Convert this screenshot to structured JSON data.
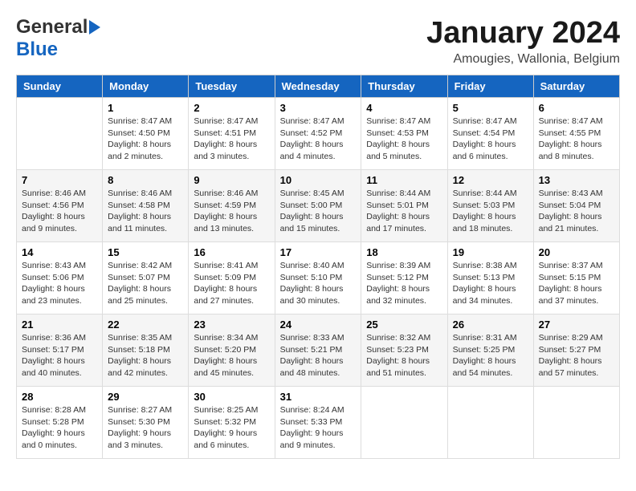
{
  "header": {
    "logo_general": "General",
    "logo_blue": "Blue",
    "month_title": "January 2024",
    "location": "Amougies, Wallonia, Belgium"
  },
  "weekdays": [
    "Sunday",
    "Monday",
    "Tuesday",
    "Wednesday",
    "Thursday",
    "Friday",
    "Saturday"
  ],
  "weeks": [
    [
      {
        "day": "",
        "info": ""
      },
      {
        "day": "1",
        "info": "Sunrise: 8:47 AM\nSunset: 4:50 PM\nDaylight: 8 hours\nand 2 minutes."
      },
      {
        "day": "2",
        "info": "Sunrise: 8:47 AM\nSunset: 4:51 PM\nDaylight: 8 hours\nand 3 minutes."
      },
      {
        "day": "3",
        "info": "Sunrise: 8:47 AM\nSunset: 4:52 PM\nDaylight: 8 hours\nand 4 minutes."
      },
      {
        "day": "4",
        "info": "Sunrise: 8:47 AM\nSunset: 4:53 PM\nDaylight: 8 hours\nand 5 minutes."
      },
      {
        "day": "5",
        "info": "Sunrise: 8:47 AM\nSunset: 4:54 PM\nDaylight: 8 hours\nand 6 minutes."
      },
      {
        "day": "6",
        "info": "Sunrise: 8:47 AM\nSunset: 4:55 PM\nDaylight: 8 hours\nand 8 minutes."
      }
    ],
    [
      {
        "day": "7",
        "info": "Sunrise: 8:46 AM\nSunset: 4:56 PM\nDaylight: 8 hours\nand 9 minutes."
      },
      {
        "day": "8",
        "info": "Sunrise: 8:46 AM\nSunset: 4:58 PM\nDaylight: 8 hours\nand 11 minutes."
      },
      {
        "day": "9",
        "info": "Sunrise: 8:46 AM\nSunset: 4:59 PM\nDaylight: 8 hours\nand 13 minutes."
      },
      {
        "day": "10",
        "info": "Sunrise: 8:45 AM\nSunset: 5:00 PM\nDaylight: 8 hours\nand 15 minutes."
      },
      {
        "day": "11",
        "info": "Sunrise: 8:44 AM\nSunset: 5:01 PM\nDaylight: 8 hours\nand 17 minutes."
      },
      {
        "day": "12",
        "info": "Sunrise: 8:44 AM\nSunset: 5:03 PM\nDaylight: 8 hours\nand 18 minutes."
      },
      {
        "day": "13",
        "info": "Sunrise: 8:43 AM\nSunset: 5:04 PM\nDaylight: 8 hours\nand 21 minutes."
      }
    ],
    [
      {
        "day": "14",
        "info": "Sunrise: 8:43 AM\nSunset: 5:06 PM\nDaylight: 8 hours\nand 23 minutes."
      },
      {
        "day": "15",
        "info": "Sunrise: 8:42 AM\nSunset: 5:07 PM\nDaylight: 8 hours\nand 25 minutes."
      },
      {
        "day": "16",
        "info": "Sunrise: 8:41 AM\nSunset: 5:09 PM\nDaylight: 8 hours\nand 27 minutes."
      },
      {
        "day": "17",
        "info": "Sunrise: 8:40 AM\nSunset: 5:10 PM\nDaylight: 8 hours\nand 30 minutes."
      },
      {
        "day": "18",
        "info": "Sunrise: 8:39 AM\nSunset: 5:12 PM\nDaylight: 8 hours\nand 32 minutes."
      },
      {
        "day": "19",
        "info": "Sunrise: 8:38 AM\nSunset: 5:13 PM\nDaylight: 8 hours\nand 34 minutes."
      },
      {
        "day": "20",
        "info": "Sunrise: 8:37 AM\nSunset: 5:15 PM\nDaylight: 8 hours\nand 37 minutes."
      }
    ],
    [
      {
        "day": "21",
        "info": "Sunrise: 8:36 AM\nSunset: 5:17 PM\nDaylight: 8 hours\nand 40 minutes."
      },
      {
        "day": "22",
        "info": "Sunrise: 8:35 AM\nSunset: 5:18 PM\nDaylight: 8 hours\nand 42 minutes."
      },
      {
        "day": "23",
        "info": "Sunrise: 8:34 AM\nSunset: 5:20 PM\nDaylight: 8 hours\nand 45 minutes."
      },
      {
        "day": "24",
        "info": "Sunrise: 8:33 AM\nSunset: 5:21 PM\nDaylight: 8 hours\nand 48 minutes."
      },
      {
        "day": "25",
        "info": "Sunrise: 8:32 AM\nSunset: 5:23 PM\nDaylight: 8 hours\nand 51 minutes."
      },
      {
        "day": "26",
        "info": "Sunrise: 8:31 AM\nSunset: 5:25 PM\nDaylight: 8 hours\nand 54 minutes."
      },
      {
        "day": "27",
        "info": "Sunrise: 8:29 AM\nSunset: 5:27 PM\nDaylight: 8 hours\nand 57 minutes."
      }
    ],
    [
      {
        "day": "28",
        "info": "Sunrise: 8:28 AM\nSunset: 5:28 PM\nDaylight: 9 hours\nand 0 minutes."
      },
      {
        "day": "29",
        "info": "Sunrise: 8:27 AM\nSunset: 5:30 PM\nDaylight: 9 hours\nand 3 minutes."
      },
      {
        "day": "30",
        "info": "Sunrise: 8:25 AM\nSunset: 5:32 PM\nDaylight: 9 hours\nand 6 minutes."
      },
      {
        "day": "31",
        "info": "Sunrise: 8:24 AM\nSunset: 5:33 PM\nDaylight: 9 hours\nand 9 minutes."
      },
      {
        "day": "",
        "info": ""
      },
      {
        "day": "",
        "info": ""
      },
      {
        "day": "",
        "info": ""
      }
    ]
  ]
}
